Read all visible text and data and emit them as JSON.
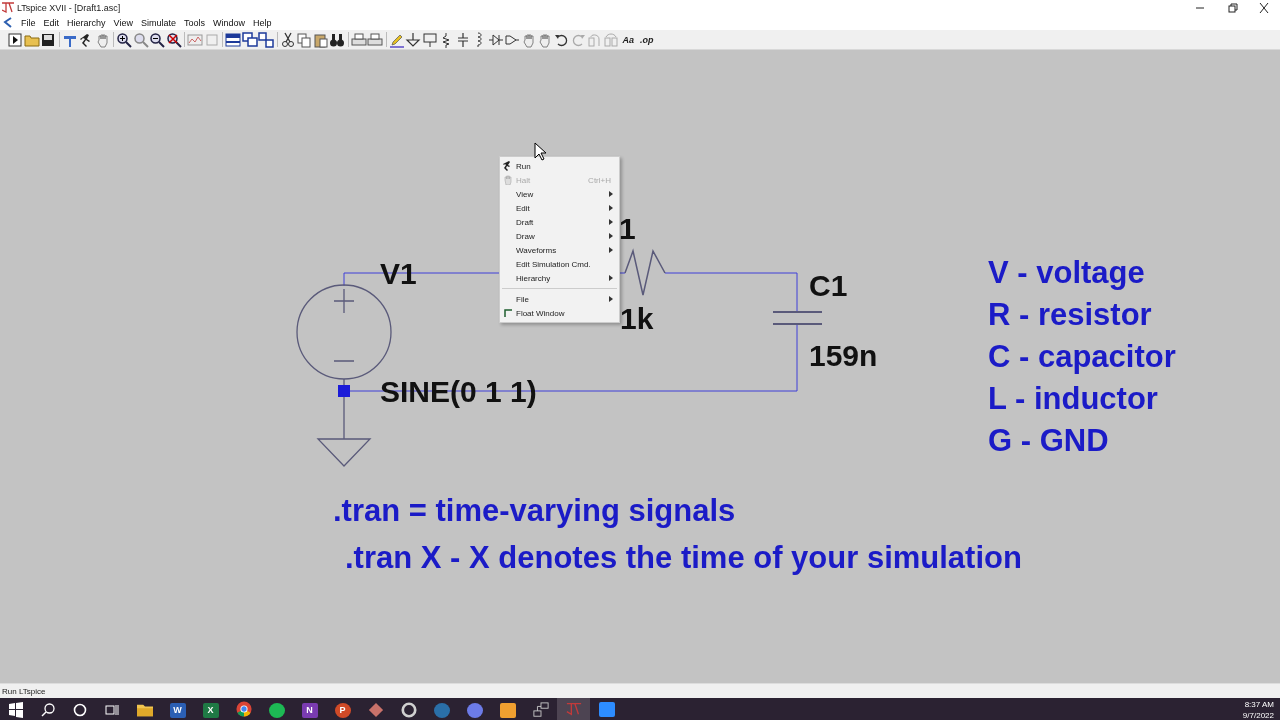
{
  "window": {
    "title": "LTspice XVII - [Draft1.asc]"
  },
  "menubar": [
    "File",
    "Edit",
    "Hierarchy",
    "View",
    "Simulate",
    "Tools",
    "Window",
    "Help"
  ],
  "toolbar": {
    "text_buttons": [
      "Aa",
      ".op"
    ]
  },
  "schematic": {
    "labels": [
      {
        "text": "V1"
      },
      {
        "text": "SINE(0 1 1)"
      },
      {
        "text": "1"
      },
      {
        "text": "1k"
      },
      {
        "text": "C1"
      },
      {
        "text": "159n"
      }
    ],
    "legend": [
      "V - voltage",
      "R - resistor",
      "C - capacitor",
      "L - inductor",
      "G - GND"
    ],
    "notes": [
      ".tran = time-varying signals",
      ".tran X - X denotes the time of your simulation"
    ]
  },
  "context_menu": {
    "items": [
      {
        "kind": "run",
        "label": "Run",
        "disabled": false
      },
      {
        "kind": "halt",
        "label": "Halt",
        "disabled": true,
        "shortcut": "Ctrl+H"
      },
      {
        "kind": "submenu",
        "label": "View",
        "disabled": false
      },
      {
        "kind": "submenu",
        "label": "Edit",
        "disabled": false
      },
      {
        "kind": "submenu",
        "label": "Draft",
        "disabled": false
      },
      {
        "kind": "submenu",
        "label": "Draw",
        "disabled": false
      },
      {
        "kind": "submenu",
        "label": "Waveforms",
        "disabled": false
      },
      {
        "kind": "command",
        "label": "Edit Simulation Cmd.",
        "disabled": false
      },
      {
        "kind": "submenu",
        "label": "Hierarchy",
        "disabled": false
      },
      {
        "kind": "separator"
      },
      {
        "kind": "submenu",
        "label": "File",
        "disabled": false
      },
      {
        "kind": "check",
        "label": "Float Window",
        "checked": false
      }
    ]
  },
  "status_bar": {
    "text": "Run LTspice"
  },
  "taskbar": {
    "apps": [
      {
        "kind": "folder",
        "running": false,
        "selected": false
      },
      {
        "kind": "tile",
        "label": "W",
        "color": "#2b5fb4",
        "running": false,
        "selected": false
      },
      {
        "kind": "tile",
        "label": "X",
        "color": "#1f7a45",
        "running": false,
        "selected": false
      },
      {
        "kind": "chrome",
        "running": true,
        "selected": false
      },
      {
        "kind": "round",
        "color": "#1db954",
        "running": false,
        "selected": false
      },
      {
        "kind": "tile",
        "label": "N",
        "color": "#7a3bb0",
        "running": false,
        "selected": false
      },
      {
        "kind": "round",
        "label": "P",
        "color": "#d04a27",
        "running": false,
        "selected": false
      },
      {
        "kind": "diamond",
        "color": "#c9726a",
        "running": false,
        "selected": false
      },
      {
        "kind": "ring",
        "color": "#d0d0d0",
        "running": false,
        "selected": false
      },
      {
        "kind": "round",
        "color": "#2a6fa8",
        "running": false,
        "selected": false
      },
      {
        "kind": "round",
        "color": "#6c7be8",
        "running": false,
        "selected": false
      },
      {
        "kind": "tile",
        "color": "#f0a030",
        "running": false,
        "selected": false
      },
      {
        "kind": "network",
        "running": false,
        "selected": false
      },
      {
        "kind": "ltspice",
        "running": true,
        "selected": true
      },
      {
        "kind": "tile",
        "color": "#2d8cff",
        "running": true,
        "selected": false
      }
    ],
    "time": "8:37 AM",
    "date": "9/7/2022"
  }
}
